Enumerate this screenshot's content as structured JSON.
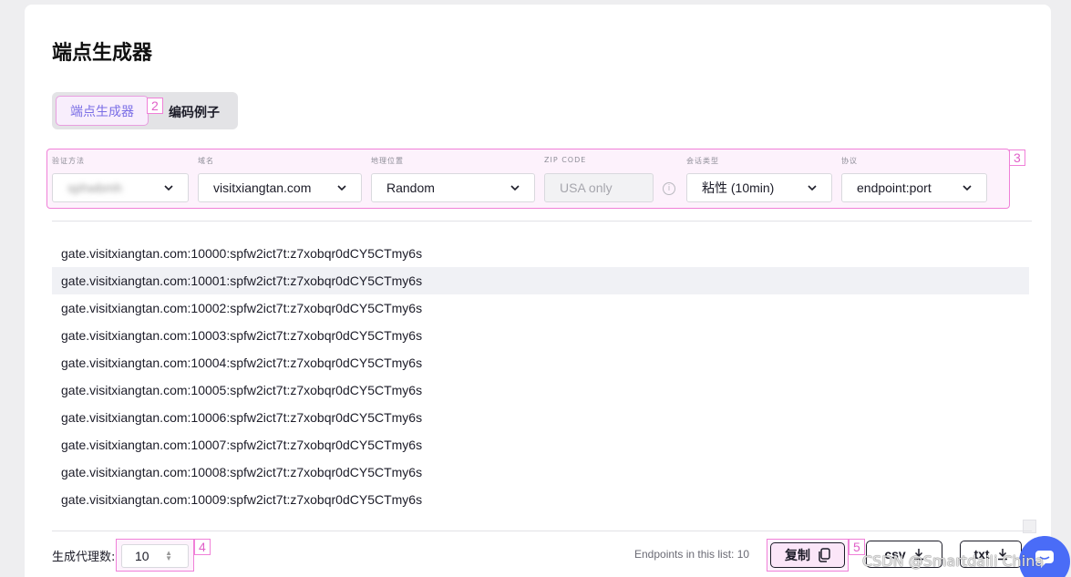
{
  "page": {
    "title": "端点生成器"
  },
  "tabs": [
    {
      "label": "端点生成器",
      "active": true
    },
    {
      "label": "编码例子",
      "active": false
    }
  ],
  "annotations": [
    "2",
    "3",
    "4",
    "5"
  ],
  "filters": {
    "auth": {
      "label": "验证方法",
      "value": "sphwbmh"
    },
    "domain": {
      "label": "域名",
      "value": "visitxiangtan.com"
    },
    "location": {
      "label": "地理位置",
      "value": "Random"
    },
    "zip": {
      "label": "ZIP CODE",
      "placeholder": "USA only"
    },
    "session": {
      "label": "会话类型",
      "value": "粘性 (10min)"
    },
    "protocol": {
      "label": "协议",
      "value": "endpoint:port"
    }
  },
  "endpoints": [
    "gate.visitxiangtan.com:10000:spfw2ict7t:z7xobqr0dCY5CTmy6s",
    "gate.visitxiangtan.com:10001:spfw2ict7t:z7xobqr0dCY5CTmy6s",
    "gate.visitxiangtan.com:10002:spfw2ict7t:z7xobqr0dCY5CTmy6s",
    "gate.visitxiangtan.com:10003:spfw2ict7t:z7xobqr0dCY5CTmy6s",
    "gate.visitxiangtan.com:10004:spfw2ict7t:z7xobqr0dCY5CTmy6s",
    "gate.visitxiangtan.com:10005:spfw2ict7t:z7xobqr0dCY5CTmy6s",
    "gate.visitxiangtan.com:10006:spfw2ict7t:z7xobqr0dCY5CTmy6s",
    "gate.visitxiangtan.com:10007:spfw2ict7t:z7xobqr0dCY5CTmy6s",
    "gate.visitxiangtan.com:10008:spfw2ict7t:z7xobqr0dCY5CTmy6s",
    "gate.visitxiangtan.com:10009:spfw2ict7t:z7xobqr0dCY5CTmy6s"
  ],
  "footer": {
    "count_label": "生成代理数:",
    "count_value": "10",
    "endpoints_note": "Endpoints in this list: 10",
    "copy_label": "复制",
    "csv_label": "csv",
    "txt_label": "txt"
  },
  "watermark": "CSDN @Smartdaili China",
  "colors": {
    "accent": "#7a6ee6",
    "annotation": "#f080d8",
    "chat": "#4a6cf7"
  },
  "icons": [
    "chevron-down-icon",
    "info-icon",
    "copy-icon",
    "download-icon",
    "chat-icon"
  ]
}
